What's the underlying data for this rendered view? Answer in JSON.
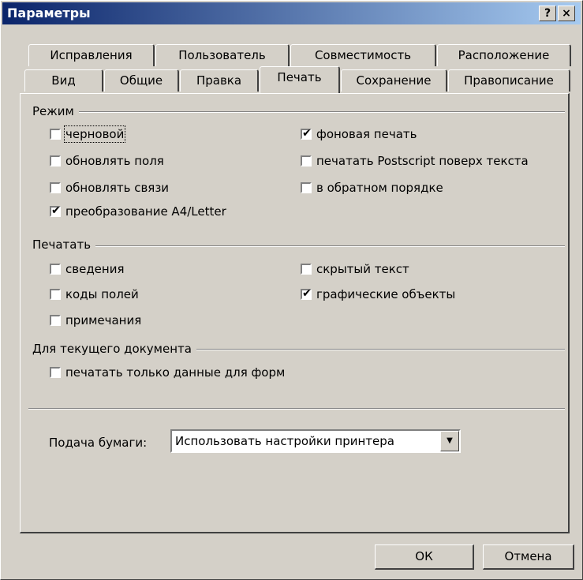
{
  "window": {
    "title": "Параметры",
    "help_label": "?",
    "close_label": "×"
  },
  "tabs_back": [
    "Исправления",
    "Пользователь",
    "Совместимость",
    "Расположение"
  ],
  "tabs_front": [
    "Вид",
    "Общие",
    "Правка",
    "Печать",
    "Сохранение",
    "Правописание"
  ],
  "active_tab": "Печать",
  "groups": {
    "mode": "Режим",
    "print": "Печатать",
    "doc": "Для текущего документа"
  },
  "checkboxes": {
    "draft": {
      "label": "черновой",
      "checked": false
    },
    "update_fields": {
      "label": "обновлять поля",
      "checked": false
    },
    "update_links": {
      "label": "обновлять связи",
      "checked": false
    },
    "a4_letter": {
      "label": "преобразование A4/Letter",
      "checked": true
    },
    "background": {
      "label": "фоновая печать",
      "checked": true
    },
    "postscript": {
      "label": "печатать Postscript поверх текста",
      "checked": false
    },
    "reverse": {
      "label": "в обратном порядке",
      "checked": false
    },
    "summary": {
      "label": "сведения",
      "checked": false
    },
    "field_codes": {
      "label": "коды полей",
      "checked": false
    },
    "comments": {
      "label": "примечания",
      "checked": false
    },
    "hidden_text": {
      "label": "скрытый текст",
      "checked": false
    },
    "drawing_objects": {
      "label": "графические объекты",
      "checked": true
    },
    "form_data": {
      "label": "печатать только данные для форм",
      "checked": false
    }
  },
  "paper": {
    "label": "Подача бумаги:",
    "value": "Использовать настройки принтера"
  },
  "buttons": {
    "ok": "ОК",
    "cancel": "Отмена"
  }
}
